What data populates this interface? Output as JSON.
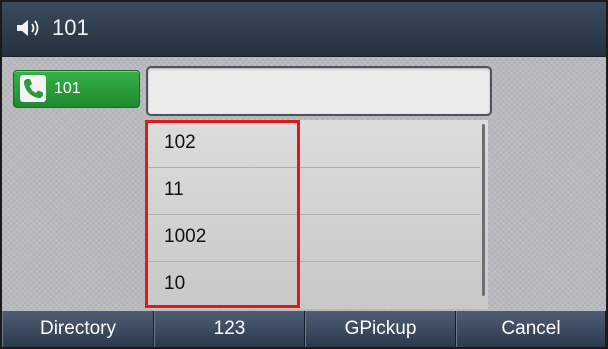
{
  "title": {
    "icon": "speaker-icon",
    "text": "101"
  },
  "line_key": {
    "icon": "phone-icon",
    "label": "101",
    "color": "#2a9b38"
  },
  "dial_input": {
    "value": ""
  },
  "suggestions": [
    {
      "label": "102"
    },
    {
      "label": "11"
    },
    {
      "label": "1002"
    },
    {
      "label": "10"
    }
  ],
  "softkeys": [
    {
      "label": "Directory"
    },
    {
      "label": "123"
    },
    {
      "label": "GPickup"
    },
    {
      "label": "Cancel"
    }
  ],
  "highlight_color": "#e01818"
}
